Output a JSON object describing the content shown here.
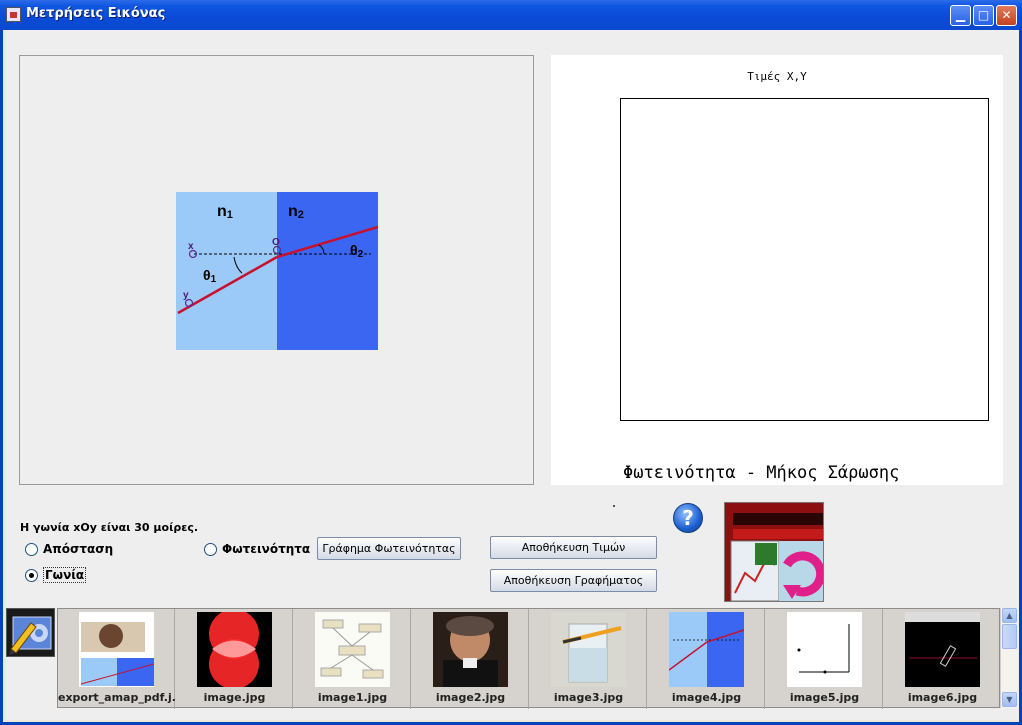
{
  "window": {
    "title": "Μετρήσεις Εικόνας",
    "icons": {
      "app": "java-app-icon",
      "minimize": "minimize-icon",
      "maximize": "maximize-icon",
      "close": "close-icon"
    }
  },
  "image_view": {
    "labels": {
      "n1": "n",
      "n1_sub": "1",
      "n2": "n",
      "n2_sub": "2",
      "x": "x",
      "o": "O",
      "y": "y",
      "theta1": "θ",
      "theta1_sub": "1",
      "theta2": "θ",
      "theta2_sub": "2"
    },
    "colors": {
      "medium1": "#9ccaf8",
      "medium2": "#3a66f2",
      "ray": "#c8102e"
    }
  },
  "plot": {
    "title": "Τιμές Χ,Υ",
    "xlabel": "Φωτεινότητα - Μήκος Σάρωσης"
  },
  "controls": {
    "message": "Η γωνία xOy είναι 30 μοίρες.",
    "radio_distance": "Απόσταση",
    "radio_angle": "Γωνία",
    "radio_brightness": "Φωτεινότητα",
    "selected": "angle",
    "btn_brightness_graph": "Γράφημα Φωτεινότητας",
    "btn_save_values": "Αποθήκευση Τιμών",
    "btn_save_graph": "Αποθήκευση Γραφήματος",
    "help_glyph": "?"
  },
  "thumbnails": [
    {
      "name": "export_amap_pdf.j..."
    },
    {
      "name": "image.jpg"
    },
    {
      "name": "image1.jpg"
    },
    {
      "name": "image2.jpg"
    },
    {
      "name": "image3.jpg"
    },
    {
      "name": "image4.jpg"
    },
    {
      "name": "image5.jpg"
    },
    {
      "name": "image6.jpg"
    }
  ]
}
